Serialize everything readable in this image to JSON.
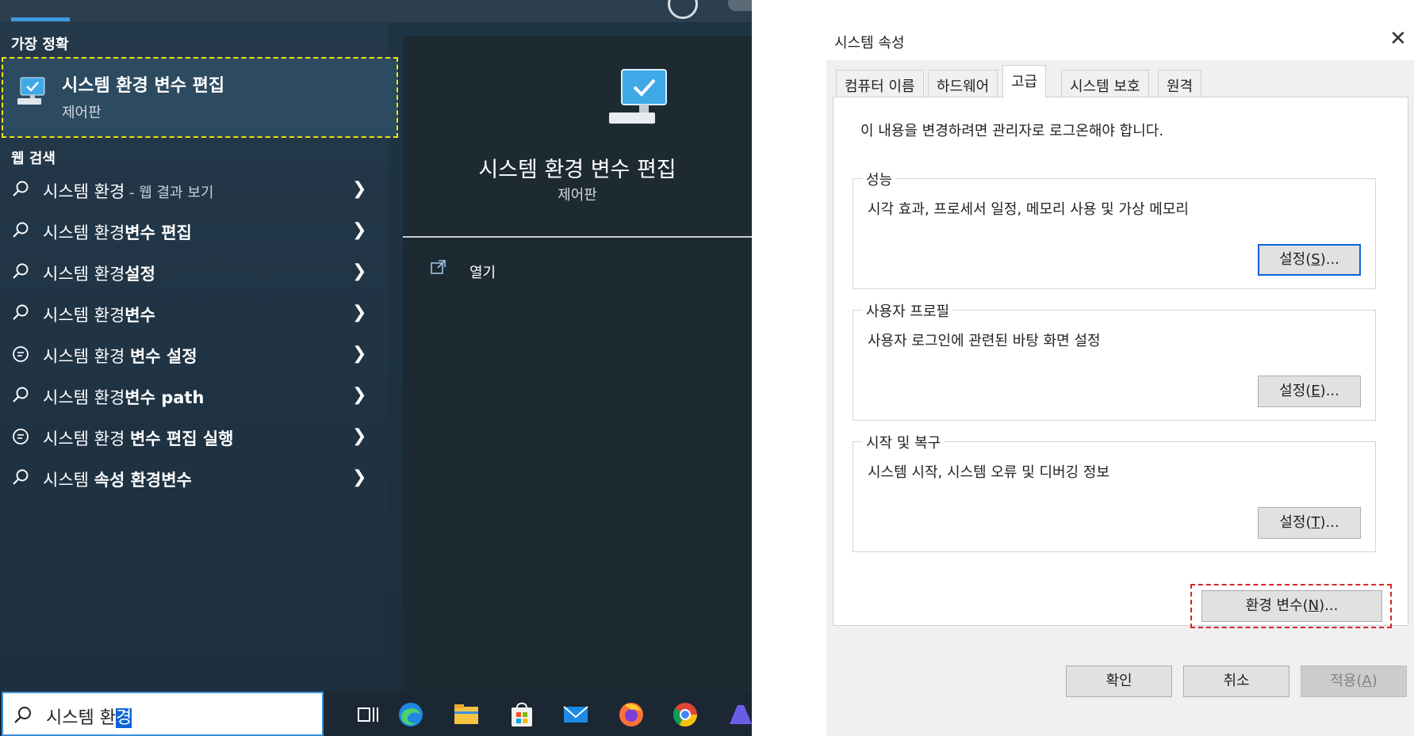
{
  "search_panel": {
    "best_match_label": "가장 정확",
    "best_match": {
      "title": "시스템 환경 변수 편집",
      "subtitle": "제어판"
    },
    "web_search_label": "웹 검색",
    "web_results": [
      {
        "pre": "시스템 환경",
        "bold": "",
        "suffix": " - 웹 결과 보기",
        "icon": "search-icon"
      },
      {
        "pre": "시스템 환경",
        "bold": "변수 편집",
        "suffix": "",
        "icon": "search-icon"
      },
      {
        "pre": "시스템 환경",
        "bold": "설정",
        "suffix": "",
        "icon": "search-icon"
      },
      {
        "pre": "시스템 환경",
        "bold": "변수",
        "suffix": "",
        "icon": "search-icon"
      },
      {
        "pre": "시스템 환경 ",
        "bold": "변수 설정",
        "suffix": "",
        "icon": "chat-icon"
      },
      {
        "pre": "시스템 환경",
        "bold": "변수 path",
        "suffix": "",
        "icon": "search-icon"
      },
      {
        "pre": "시스템 환경 ",
        "bold": "변수 편집 실행",
        "suffix": "",
        "icon": "chat-icon"
      },
      {
        "pre": "시스템 ",
        "bold": "속성 환경변수",
        "suffix": "",
        "icon": "search-icon"
      }
    ],
    "preview": {
      "title": "시스템 환경 변수 편집",
      "subtitle": "제어판",
      "open_label": "열기"
    },
    "search_query_plain": "시스템 환",
    "search_query_selected": "경"
  },
  "taskbar": {
    "icons": [
      "task-view-icon",
      "edge-icon",
      "file-explorer-icon",
      "store-icon",
      "mail-icon",
      "firefox-icon",
      "chrome-icon",
      "copilot-icon"
    ]
  },
  "dialog": {
    "title": "시스템 속성",
    "close": "✕",
    "tabs": [
      "컴퓨터 이름",
      "하드웨어",
      "고급",
      "시스템 보호",
      "원격"
    ],
    "active_tab": "고급",
    "notice": "이 내용을 변경하려면 관리자로 로그온해야 합니다.",
    "groups": [
      {
        "legend": "성능",
        "description": "시각 효과, 프로세서 일정, 메모리 사용 및 가상 메모리",
        "button_text": "설정(",
        "button_key": "S",
        "button_tail": ")..."
      },
      {
        "legend": "사용자 프로필",
        "description": "사용자 로그인에 관련된 바탕 화면 설정",
        "button_text": "설정(",
        "button_key": "E",
        "button_tail": ")..."
      },
      {
        "legend": "시작 및 복구",
        "description": "시스템 시작, 시스템 오류 및 디버깅 정보",
        "button_text": "설정(",
        "button_key": "T",
        "button_tail": ")..."
      }
    ],
    "env_button": {
      "text": "환경 변수(",
      "key": "N",
      "tail": ")..."
    },
    "footer": {
      "ok": "확인",
      "cancel": "취소",
      "apply_text": "적용(",
      "apply_key": "A",
      "apply_tail": ")"
    }
  },
  "colors": {
    "accent_blue": "#0a64d8",
    "highlight_yellow": "#f2e600",
    "highlight_red": "#d8262a"
  }
}
